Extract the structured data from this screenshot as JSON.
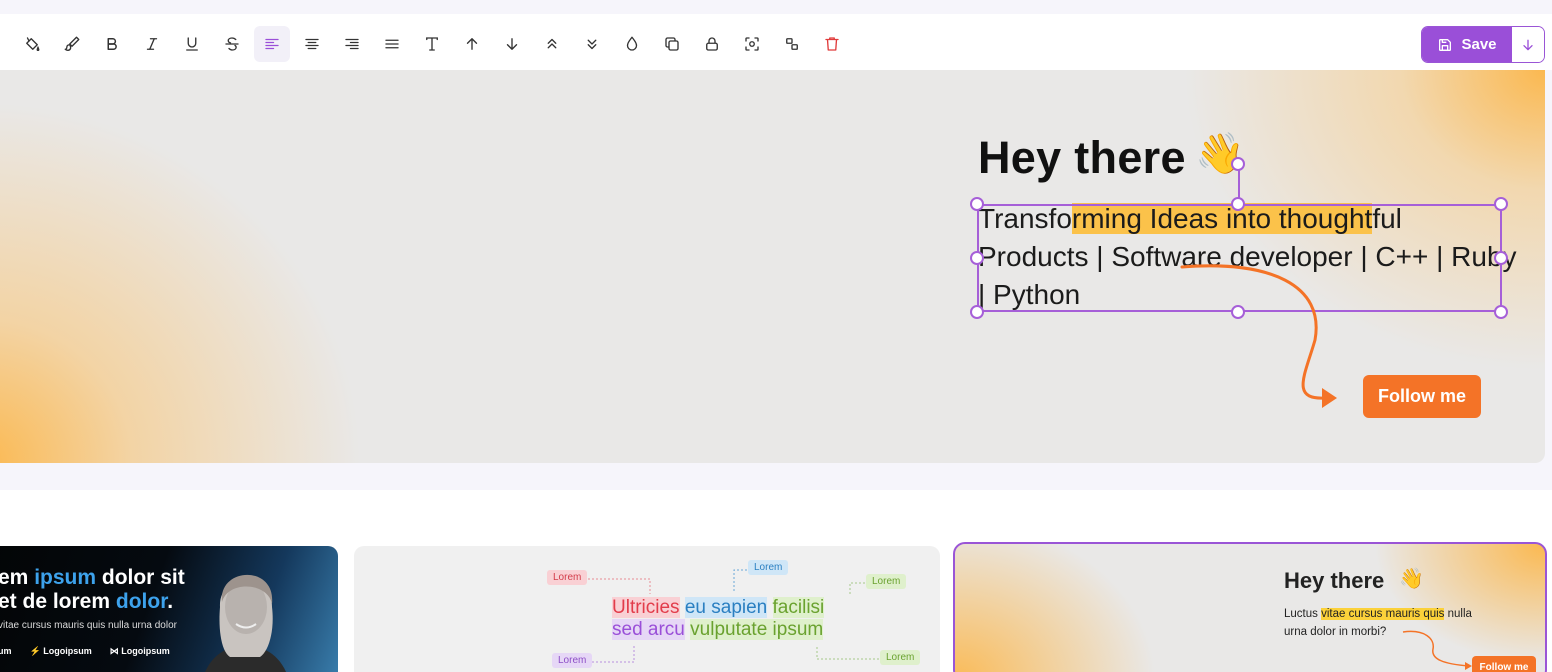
{
  "toolbar": {
    "tools": [
      {
        "name": "fill-bucket-icon"
      },
      {
        "name": "brush-icon"
      },
      {
        "name": "bold-icon"
      },
      {
        "name": "italic-icon"
      },
      {
        "name": "underline-icon"
      },
      {
        "name": "strikethrough-icon"
      },
      {
        "name": "align-left-icon",
        "active": true
      },
      {
        "name": "align-center-icon"
      },
      {
        "name": "align-right-icon"
      },
      {
        "name": "align-justify-icon"
      },
      {
        "name": "text-icon"
      },
      {
        "name": "arrow-up-icon"
      },
      {
        "name": "arrow-down-icon"
      },
      {
        "name": "bring-to-front-icon"
      },
      {
        "name": "send-to-back-icon"
      },
      {
        "name": "opacity-drop-icon"
      },
      {
        "name": "duplicate-icon"
      },
      {
        "name": "lock-icon"
      },
      {
        "name": "focus-icon"
      },
      {
        "name": "group-icon"
      },
      {
        "name": "trash-icon"
      }
    ],
    "save_label": "Save",
    "accent": "#9a4fd8",
    "danger": "#e03b3b"
  },
  "banner": {
    "heading": "Hey there",
    "emoji": "👋",
    "tagline_before": "Transfo",
    "tagline_highlight": "rming Ideas into thought",
    "tagline_after": "ful Products | Software developer | C++ | Ruby | Python",
    "highlight_color": "#fbc24a",
    "button_label": "Follow me",
    "button_color": "#f47327",
    "gradient_color": "#fcb648"
  },
  "templates": {
    "card1": {
      "title_part1": "em ",
      "title_blue1": "ipsum",
      "title_part2": " dolor sit",
      "title_line2": "et de lorem ",
      "title_blue2": "dolor",
      "title_end": ".",
      "subtitle": "vitae cursus mauris quis nulla urna dolor",
      "logos": [
        "um",
        "Logoipsum",
        "Logoipsum"
      ]
    },
    "card2": {
      "chips": [
        "Lorem",
        "Lorem",
        "Lorem",
        "Lorem",
        "Lorem"
      ],
      "words": [
        {
          "text": "Ultricies",
          "color": "#e23c4a",
          "bg": "#f9d0d4"
        },
        {
          "text": "eu sapien",
          "color": "#2a7fc1",
          "bg": "#cfe6f7"
        },
        {
          "text": "facilisi",
          "color": "#6aa22f",
          "bg": "#dff0cc"
        },
        {
          "text": "sed arcu",
          "color": "#9a4fd8",
          "bg": "#e6d7f6"
        },
        {
          "text": "vulputate ipsum",
          "color": "#6aa22f",
          "bg": "#dff0cc"
        }
      ]
    },
    "card3": {
      "heading": "Hey there",
      "emoji": "👋",
      "text_before": "Luctus ",
      "text_highlight": "vitae cursus mauris quis",
      "text_after": " nulla urna dolor in morbi?",
      "button_label": "Follow me"
    }
  }
}
